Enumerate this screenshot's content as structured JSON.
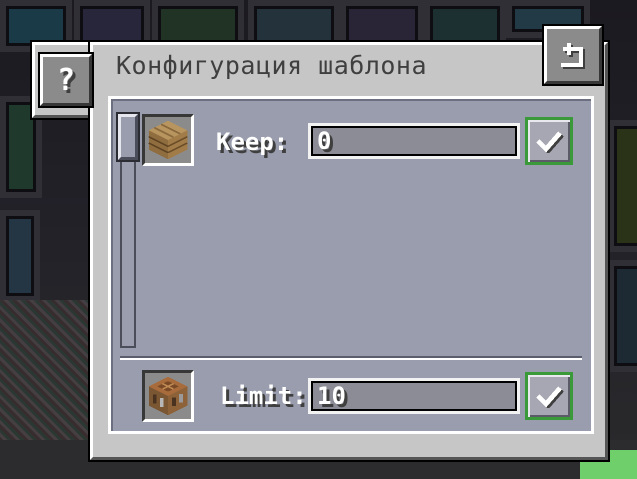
{
  "window": {
    "title": "Конфигурация шаблона",
    "help_label": "?"
  },
  "rows": [
    {
      "item_icon": "oak-planks-icon",
      "label": "Keep:",
      "value": "0"
    },
    {
      "item_icon": "crafting-table-icon",
      "label": "Limit:",
      "value": "10"
    }
  ],
  "buttons": {
    "confirm_icon": "checkmark-icon",
    "back_icon": "back-arrow-icon"
  },
  "colors": {
    "panel": "#c6c6c6",
    "inner": "#9a9dae",
    "confirm_border": "#3a9a3a"
  }
}
